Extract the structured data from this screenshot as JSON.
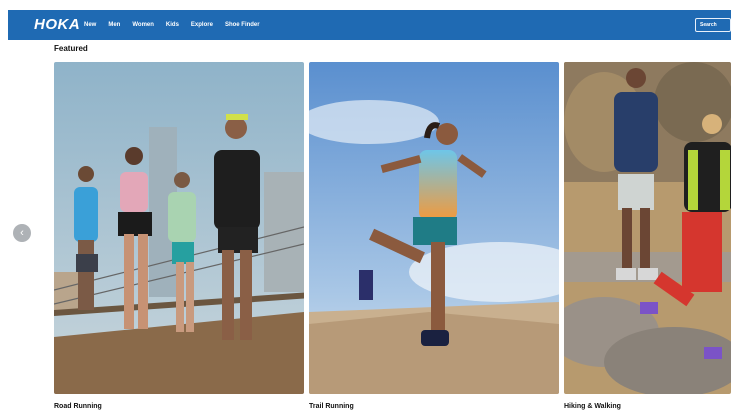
{
  "header": {
    "logo": "HOKA",
    "nav": [
      "New",
      "Men",
      "Women",
      "Kids",
      "Explore",
      "Shoe Finder"
    ],
    "search_label": "Search"
  },
  "section": {
    "title": "Featured"
  },
  "cards": [
    {
      "label": "Road Running"
    },
    {
      "label": "Trail Running"
    },
    {
      "label": "Hiking & Walking"
    }
  ],
  "icons": {
    "prev": "chevron-left-icon",
    "prev_glyph": "‹"
  },
  "colors": {
    "header_bg": "#1f6ab3",
    "arrow_bg": "#aeb2b6"
  }
}
